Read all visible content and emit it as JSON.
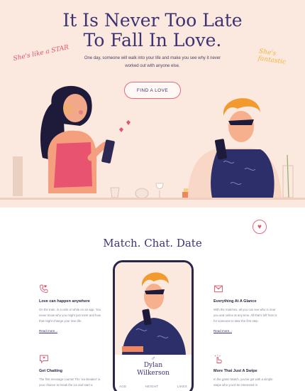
{
  "hero": {
    "title_line1": "It Is Never Too Late",
    "title_line2": "To Fall In Love.",
    "subtitle": "One day, someone will walk into your life and make you see why it never worked out with anyone else.",
    "button_label": "FIND A LOVE",
    "sticker_left": "She's like a STAR",
    "sticker_right": "She's fantastic"
  },
  "section": {
    "title": "Match. Chat. Date"
  },
  "phone": {
    "gender_symbol": "♂",
    "name_line1": "Dylan",
    "name_line2": "Wilkerson",
    "stats": [
      "AGE",
      "HEIGHT",
      "LIKES"
    ]
  },
  "features": {
    "love": {
      "title": "Love can happen anywhere",
      "body": "On the train, in a cafe or while on an app. You never know who you might just meet and how that might change your love life.",
      "link": "Read more..."
    },
    "glance": {
      "title": "Everything At A Glance",
      "body": "With the matches, all you can see who is near you and online at any time. All that's left from is for someone to take the first step.",
      "link": "Read more..."
    },
    "chatting": {
      "title": "Get Chatting",
      "body": "The first message counts! The 'ice-breaker' is your chance to break the ice and start a"
    },
    "swipe": {
      "title": "More That Just A Swipe",
      "body": "In the game Match, you've got with a simple swipe who you'd be interested in"
    }
  },
  "colors": {
    "brand": "#3d3373",
    "accent": "#e2566b",
    "hero_bg": "#fbe8de"
  }
}
